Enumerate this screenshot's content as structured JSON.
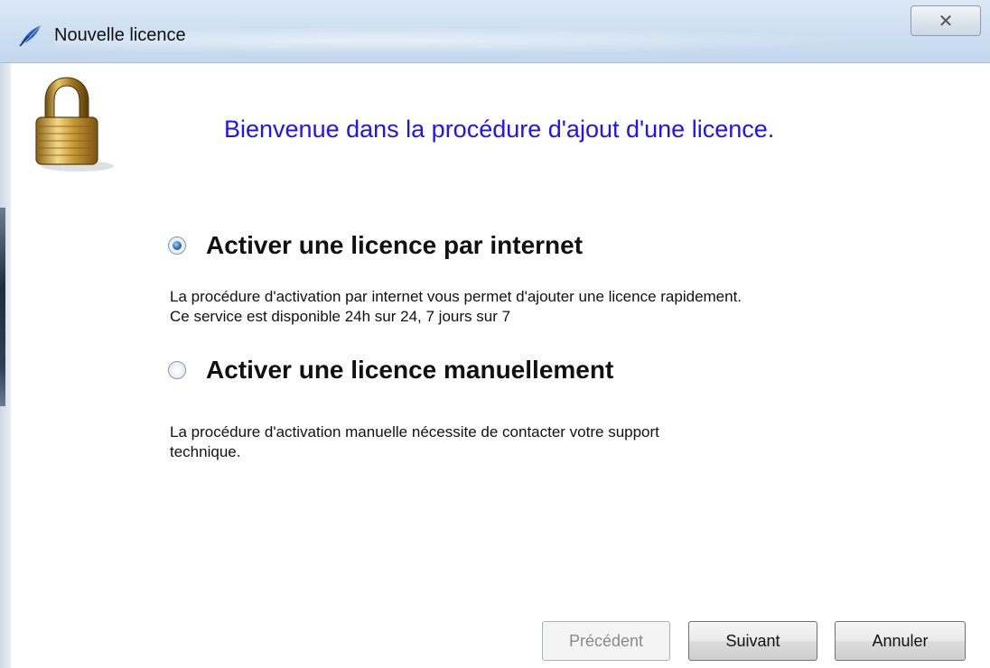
{
  "window": {
    "title": "Nouvelle licence",
    "close_symbol": "✕"
  },
  "header": {
    "heading": "Bienvenue dans la procédure d'ajout d'une licence.",
    "icon": "padlock-icon"
  },
  "options": [
    {
      "label": "Activer une licence par internet",
      "checked": true,
      "description_lines": [
        "La procédure d'activation par internet vous permet d'ajouter une licence rapidement.",
        "Ce service est disponible 24h sur 24, 7 jours sur 7"
      ]
    },
    {
      "label": "Activer une licence manuellement",
      "checked": false,
      "description_lines": [
        "La procédure d'activation manuelle nécessite de contacter votre support",
        "technique."
      ]
    }
  ],
  "buttons": {
    "previous": "Précédent",
    "next": "Suivant",
    "cancel": "Annuler"
  },
  "colors": {
    "heading": "#1f12ff",
    "titlebar": "#cfe0f2"
  }
}
